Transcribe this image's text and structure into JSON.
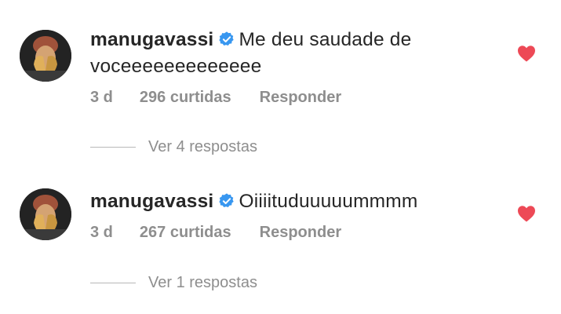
{
  "comments": [
    {
      "username": "manugavassi",
      "verified_icon": "verified-badge-icon",
      "text": "Me deu saudade de voceeeeeeeeeeeee",
      "time": "3 d",
      "likes": "296 curtidas",
      "reply_label": "Responder",
      "replies_label": "Ver 4 respostas",
      "liked": true
    },
    {
      "username": "manugavassi",
      "verified_icon": "verified-badge-icon",
      "text": "Oiiiituduuuuummmm",
      "time": "3 d",
      "likes": "267 curtidas",
      "reply_label": "Responder",
      "replies_label": "Ver 1 respostas",
      "liked": true
    }
  ],
  "colors": {
    "text": "#262626",
    "secondary": "#8e8e8e",
    "verified": "#3897f0",
    "heart": "#ed4956"
  }
}
